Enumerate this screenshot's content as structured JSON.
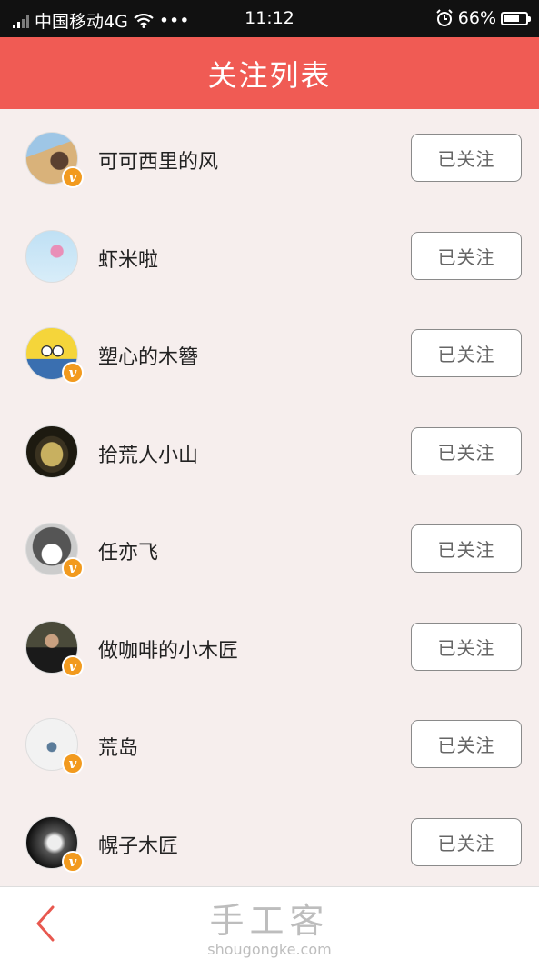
{
  "status_bar": {
    "carrier": "中国移动4G",
    "dots": "•••",
    "time": "11:12",
    "battery": "66%",
    "battery_level": 0.66
  },
  "header": {
    "title": "关注列表"
  },
  "follow_list": [
    {
      "name": "可可西里的风",
      "button": "已关注",
      "avatar": "desert-person",
      "verified": true
    },
    {
      "name": "虾米啦",
      "button": "已关注",
      "avatar": "pink-flower",
      "verified": false
    },
    {
      "name": "塑心的木簪",
      "button": "已关注",
      "avatar": "minion",
      "verified": true
    },
    {
      "name": "拾荒人小山",
      "button": "已关注",
      "avatar": "bowl",
      "verified": false
    },
    {
      "name": "任亦飞",
      "button": "已关注",
      "avatar": "husky-dog",
      "verified": true
    },
    {
      "name": "做咖啡的小木匠",
      "button": "已关注",
      "avatar": "man-portrait",
      "verified": true
    },
    {
      "name": "荒岛",
      "button": "已关注",
      "avatar": "small-object",
      "verified": true
    },
    {
      "name": "幌子木匠",
      "button": "已关注",
      "avatar": "bw-photo",
      "verified": true
    }
  ],
  "footer": {
    "logo_cn": "手工客",
    "logo_en": "shougongke.com",
    "back_icon": "chevron-left-icon"
  },
  "colors": {
    "accent": "#f05b54",
    "badge": "#f29a1e",
    "background": "#f6eeed"
  }
}
